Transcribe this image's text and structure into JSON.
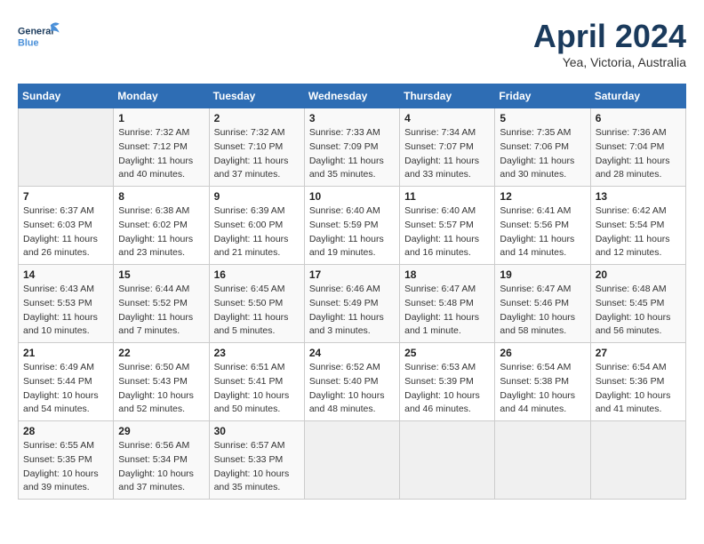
{
  "header": {
    "logo_line1": "General",
    "logo_line2": "Blue",
    "month_year": "April 2024",
    "location": "Yea, Victoria, Australia"
  },
  "days_of_week": [
    "Sunday",
    "Monday",
    "Tuesday",
    "Wednesday",
    "Thursday",
    "Friday",
    "Saturday"
  ],
  "weeks": [
    [
      {
        "day": "",
        "info": ""
      },
      {
        "day": "1",
        "info": "Sunrise: 7:32 AM\nSunset: 7:12 PM\nDaylight: 11 hours\nand 40 minutes."
      },
      {
        "day": "2",
        "info": "Sunrise: 7:32 AM\nSunset: 7:10 PM\nDaylight: 11 hours\nand 37 minutes."
      },
      {
        "day": "3",
        "info": "Sunrise: 7:33 AM\nSunset: 7:09 PM\nDaylight: 11 hours\nand 35 minutes."
      },
      {
        "day": "4",
        "info": "Sunrise: 7:34 AM\nSunset: 7:07 PM\nDaylight: 11 hours\nand 33 minutes."
      },
      {
        "day": "5",
        "info": "Sunrise: 7:35 AM\nSunset: 7:06 PM\nDaylight: 11 hours\nand 30 minutes."
      },
      {
        "day": "6",
        "info": "Sunrise: 7:36 AM\nSunset: 7:04 PM\nDaylight: 11 hours\nand 28 minutes."
      }
    ],
    [
      {
        "day": "7",
        "info": "Sunrise: 6:37 AM\nSunset: 6:03 PM\nDaylight: 11 hours\nand 26 minutes."
      },
      {
        "day": "8",
        "info": "Sunrise: 6:38 AM\nSunset: 6:02 PM\nDaylight: 11 hours\nand 23 minutes."
      },
      {
        "day": "9",
        "info": "Sunrise: 6:39 AM\nSunset: 6:00 PM\nDaylight: 11 hours\nand 21 minutes."
      },
      {
        "day": "10",
        "info": "Sunrise: 6:40 AM\nSunset: 5:59 PM\nDaylight: 11 hours\nand 19 minutes."
      },
      {
        "day": "11",
        "info": "Sunrise: 6:40 AM\nSunset: 5:57 PM\nDaylight: 11 hours\nand 16 minutes."
      },
      {
        "day": "12",
        "info": "Sunrise: 6:41 AM\nSunset: 5:56 PM\nDaylight: 11 hours\nand 14 minutes."
      },
      {
        "day": "13",
        "info": "Sunrise: 6:42 AM\nSunset: 5:54 PM\nDaylight: 11 hours\nand 12 minutes."
      }
    ],
    [
      {
        "day": "14",
        "info": "Sunrise: 6:43 AM\nSunset: 5:53 PM\nDaylight: 11 hours\nand 10 minutes."
      },
      {
        "day": "15",
        "info": "Sunrise: 6:44 AM\nSunset: 5:52 PM\nDaylight: 11 hours\nand 7 minutes."
      },
      {
        "day": "16",
        "info": "Sunrise: 6:45 AM\nSunset: 5:50 PM\nDaylight: 11 hours\nand 5 minutes."
      },
      {
        "day": "17",
        "info": "Sunrise: 6:46 AM\nSunset: 5:49 PM\nDaylight: 11 hours\nand 3 minutes."
      },
      {
        "day": "18",
        "info": "Sunrise: 6:47 AM\nSunset: 5:48 PM\nDaylight: 11 hours\nand 1 minute."
      },
      {
        "day": "19",
        "info": "Sunrise: 6:47 AM\nSunset: 5:46 PM\nDaylight: 10 hours\nand 58 minutes."
      },
      {
        "day": "20",
        "info": "Sunrise: 6:48 AM\nSunset: 5:45 PM\nDaylight: 10 hours\nand 56 minutes."
      }
    ],
    [
      {
        "day": "21",
        "info": "Sunrise: 6:49 AM\nSunset: 5:44 PM\nDaylight: 10 hours\nand 54 minutes."
      },
      {
        "day": "22",
        "info": "Sunrise: 6:50 AM\nSunset: 5:43 PM\nDaylight: 10 hours\nand 52 minutes."
      },
      {
        "day": "23",
        "info": "Sunrise: 6:51 AM\nSunset: 5:41 PM\nDaylight: 10 hours\nand 50 minutes."
      },
      {
        "day": "24",
        "info": "Sunrise: 6:52 AM\nSunset: 5:40 PM\nDaylight: 10 hours\nand 48 minutes."
      },
      {
        "day": "25",
        "info": "Sunrise: 6:53 AM\nSunset: 5:39 PM\nDaylight: 10 hours\nand 46 minutes."
      },
      {
        "day": "26",
        "info": "Sunrise: 6:54 AM\nSunset: 5:38 PM\nDaylight: 10 hours\nand 44 minutes."
      },
      {
        "day": "27",
        "info": "Sunrise: 6:54 AM\nSunset: 5:36 PM\nDaylight: 10 hours\nand 41 minutes."
      }
    ],
    [
      {
        "day": "28",
        "info": "Sunrise: 6:55 AM\nSunset: 5:35 PM\nDaylight: 10 hours\nand 39 minutes."
      },
      {
        "day": "29",
        "info": "Sunrise: 6:56 AM\nSunset: 5:34 PM\nDaylight: 10 hours\nand 37 minutes."
      },
      {
        "day": "30",
        "info": "Sunrise: 6:57 AM\nSunset: 5:33 PM\nDaylight: 10 hours\nand 35 minutes."
      },
      {
        "day": "",
        "info": ""
      },
      {
        "day": "",
        "info": ""
      },
      {
        "day": "",
        "info": ""
      },
      {
        "day": "",
        "info": ""
      }
    ]
  ]
}
